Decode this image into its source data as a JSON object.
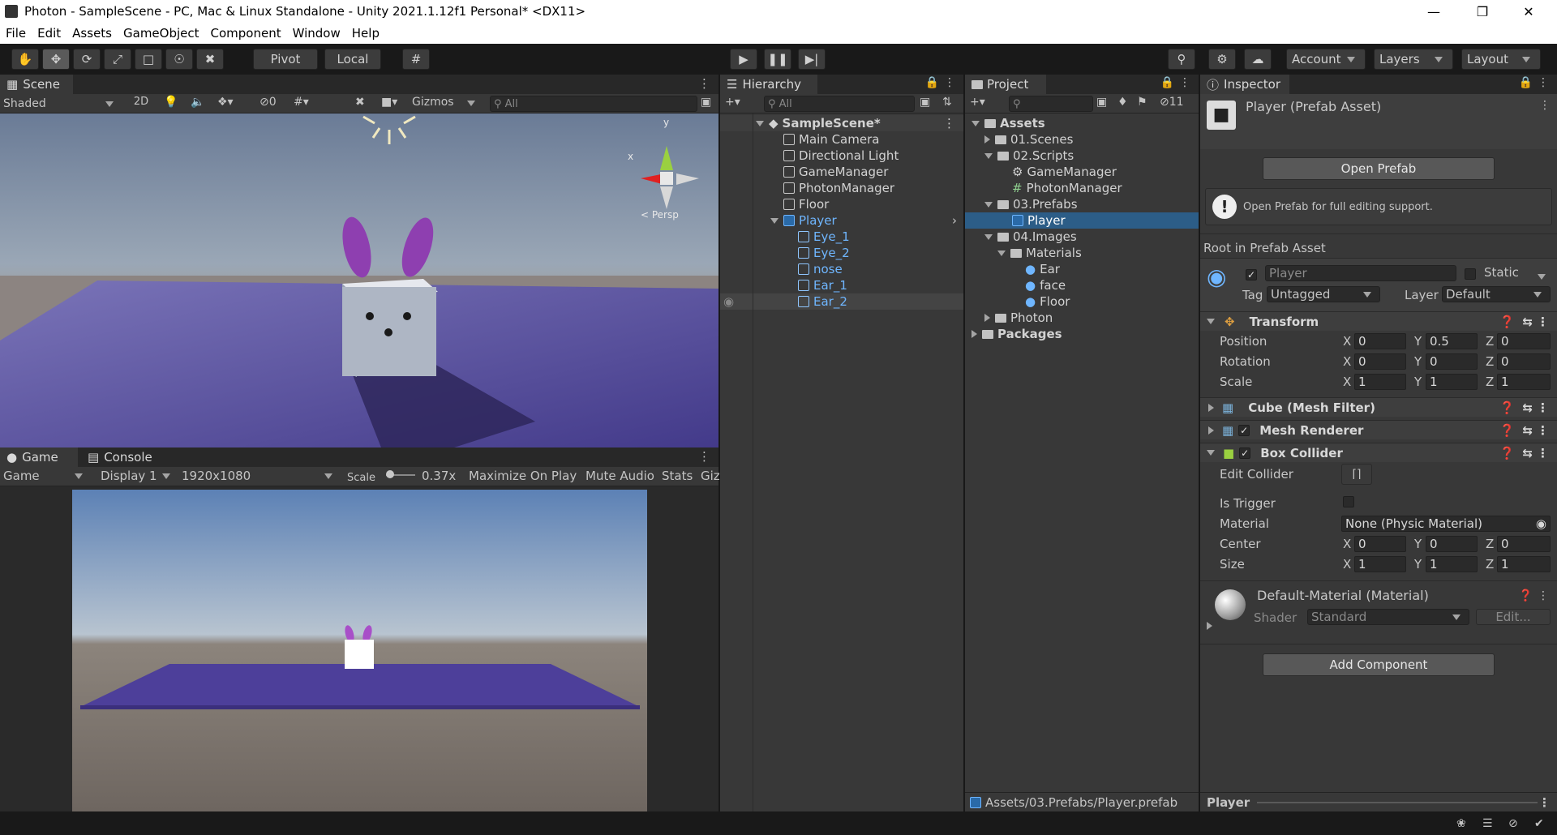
{
  "window": {
    "title": "Photon - SampleScene - PC, Mac & Linux Standalone - Unity 2021.1.12f1 Personal* <DX11>"
  },
  "menu": [
    "File",
    "Edit",
    "Assets",
    "GameObject",
    "Component",
    "Window",
    "Help"
  ],
  "toolbar": {
    "pivot_label": "Pivot",
    "local_label": "Local",
    "account_label": "Account",
    "layers_label": "Layers",
    "layout_label": "Layout"
  },
  "scene": {
    "tab": "Scene",
    "shading": "Shaded",
    "mode_2d": "2D",
    "hidden_count": "0",
    "gizmos": "Gizmos",
    "search_placeholder": "All",
    "axis_y": "y",
    "axis_x": "x",
    "persp": "< Persp"
  },
  "game": {
    "tab_game": "Game",
    "tab_console": "Console",
    "view_mode": "Game",
    "display": "Display 1",
    "resolution": "1920x1080",
    "scale_label": "Scale",
    "scale_value": "0.37x",
    "maximize": "Maximize On Play",
    "mute": "Mute Audio",
    "stats": "Stats",
    "gizmos": "Giz"
  },
  "hierarchy": {
    "tab": "Hierarchy",
    "search_placeholder": "All",
    "scene_name": "SampleScene*",
    "items": [
      "Main Camera",
      "Directional Light",
      "GameManager",
      "PhotonManager",
      "Floor"
    ],
    "player": "Player",
    "children": [
      "Eye_1",
      "Eye_2",
      "nose",
      "Ear_1",
      "Ear_2"
    ]
  },
  "project": {
    "tab": "Project",
    "hidden_count": "11",
    "assets": "Assets",
    "scenes": "01.Scenes",
    "scripts": "02.Scripts",
    "gamemanager": "GameManager",
    "photonmanager": "PhotonManager",
    "prefabs": "03.Prefabs",
    "player": "Player",
    "images": "04.Images",
    "materials": "Materials",
    "ear": "Ear",
    "face": "face",
    "floor": "Floor",
    "photon": "Photon",
    "packages": "Packages",
    "path": "Assets/03.Prefabs/Player.prefab"
  },
  "inspector": {
    "tab": "Inspector",
    "title": "Player (Prefab Asset)",
    "open_prefab": "Open Prefab",
    "notice": "Open Prefab for full editing support.",
    "root_label": "Root in Prefab Asset",
    "name_value": "Player",
    "static_label": "Static",
    "tag_label": "Tag",
    "tag_value": "Untagged",
    "layer_label": "Layer",
    "layer_value": "Default",
    "transform": {
      "title": "Transform",
      "position_label": "Position",
      "rotation_label": "Rotation",
      "scale_label": "Scale",
      "position": [
        "0",
        "0.5",
        "0"
      ],
      "rotation": [
        "0",
        "0",
        "0"
      ],
      "scale": [
        "1",
        "1",
        "1"
      ]
    },
    "mesh_filter": "Cube (Mesh Filter)",
    "mesh_renderer": "Mesh Renderer",
    "box_collider": {
      "title": "Box Collider",
      "edit_collider": "Edit Collider",
      "is_trigger": "Is Trigger",
      "material_label": "Material",
      "material_value": "None (Physic Material)",
      "center_label": "Center",
      "size_label": "Size",
      "center": [
        "0",
        "0",
        "0"
      ],
      "size": [
        "1",
        "1",
        "1"
      ]
    },
    "material": {
      "title": "Default-Material (Material)",
      "shader_label": "Shader",
      "shader_value": "Standard",
      "edit": "Edit..."
    },
    "add_component": "Add Component",
    "footer": "Player"
  },
  "axes": {
    "x": "X",
    "y": "Y",
    "z": "Z"
  },
  "colors": {
    "selection": "#2c5d87",
    "prefab_blue": "#6fb6ff",
    "floor_purple": "#574a9e",
    "ear_purple": "#8e3fb0"
  }
}
